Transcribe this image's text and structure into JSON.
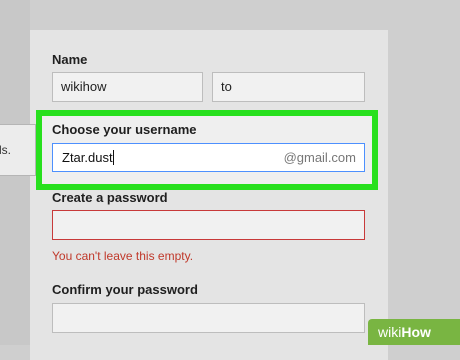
{
  "side_tooltip": {
    "text": "ls."
  },
  "form": {
    "name": {
      "label": "Name",
      "first_value": "wikihow",
      "last_value": "to"
    },
    "username": {
      "label": "Choose your username",
      "value": "Ztar.dust",
      "suffix": "@gmail.com"
    },
    "password": {
      "label": "Create a password",
      "error": "You can't leave this empty."
    },
    "confirm_password": {
      "label": "Confirm your password"
    }
  },
  "colors": {
    "highlight": "#28e01e",
    "error": "#c0392b",
    "focus_border": "#4d90fe"
  },
  "watermark": {
    "prefix": "wiki",
    "suffix": "How"
  }
}
